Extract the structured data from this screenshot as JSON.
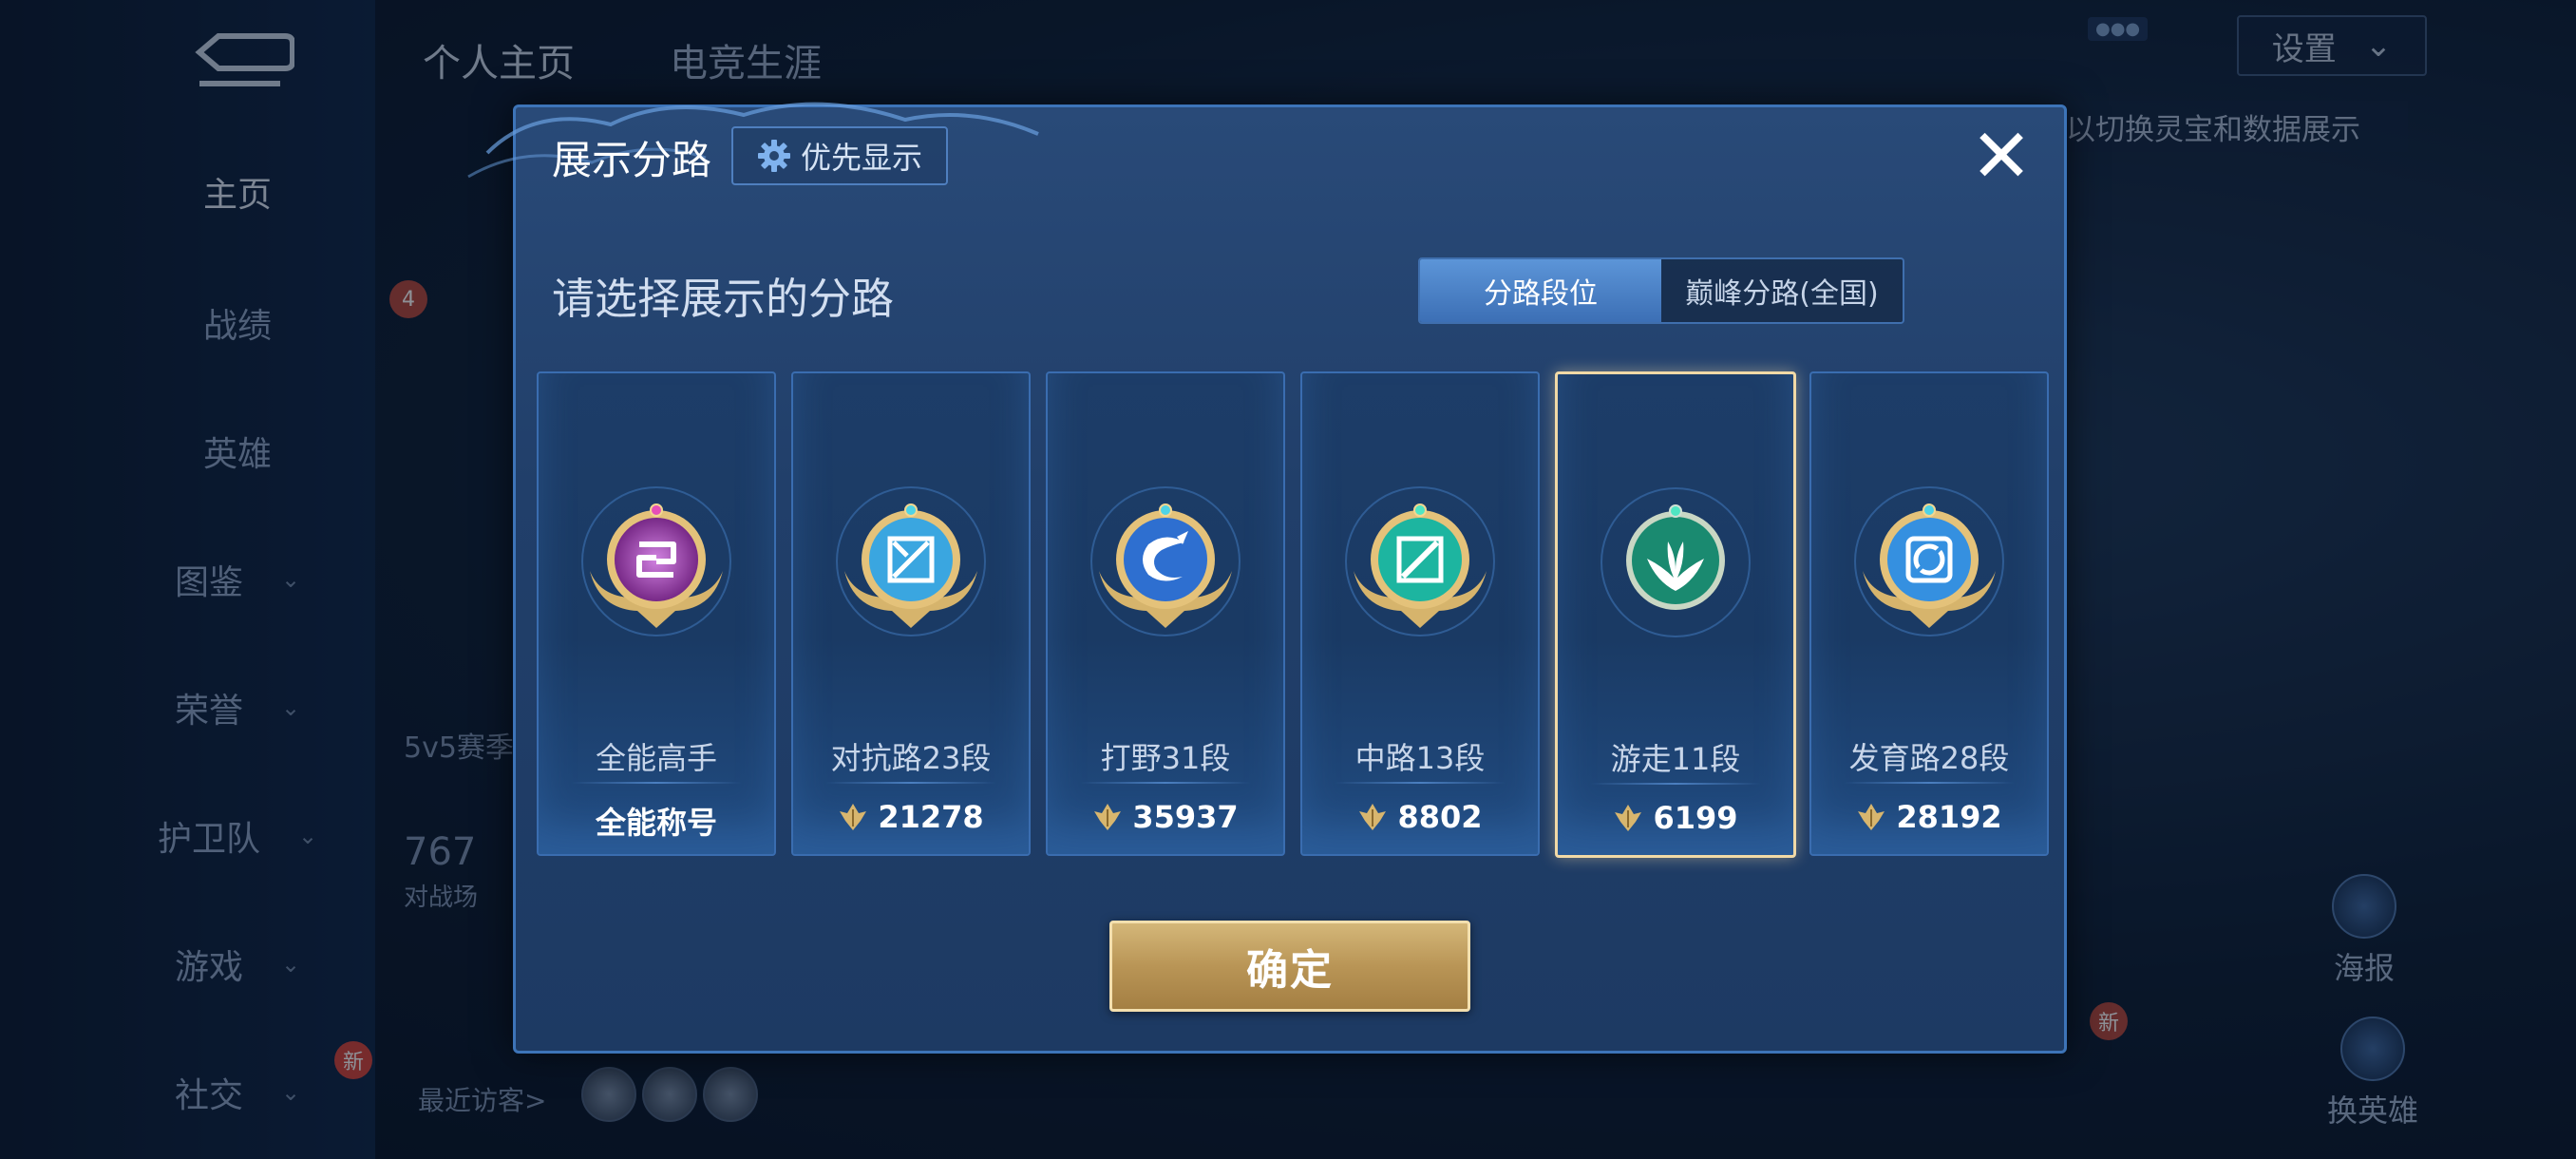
{
  "background": {
    "sidebar": {
      "items": [
        {
          "label": "主页",
          "has_chevron": false,
          "active": true
        },
        {
          "label": "战绩",
          "has_chevron": false
        },
        {
          "label": "英雄",
          "has_chevron": false
        },
        {
          "label": "图鉴",
          "has_chevron": true
        },
        {
          "label": "荣誉",
          "has_chevron": true
        },
        {
          "label": "护卫队",
          "has_chevron": true
        },
        {
          "label": "游戏",
          "has_chevron": true
        },
        {
          "label": "社交",
          "has_chevron": true
        }
      ],
      "new_badge": "新"
    },
    "top_tabs": [
      "个人主页",
      "电竞生涯"
    ],
    "settings_label": "设置",
    "hint_text": "以切换灵宝和数据展示",
    "left_info": {
      "level_badge": "4",
      "mode_text": "5v5赛季",
      "number_text": "767",
      "number_caption": "对战场"
    },
    "recent_visitors_label": "最近访客>",
    "right_buttons": [
      {
        "label": "海报"
      },
      {
        "label": "换英雄"
      }
    ],
    "right_new_badge": "新"
  },
  "modal": {
    "title": "展示分路",
    "priority_button": "优先显示",
    "close_symbol": "✕",
    "subtitle": "请选择展示的分路",
    "tabs": [
      {
        "label": "分路段位",
        "active": true
      },
      {
        "label": "巅峰分路(全国)",
        "active": false
      }
    ],
    "cards": [
      {
        "name": "全能高手",
        "score": "全能称号",
        "has_score_icon": false,
        "badge": "purple-allround-badge",
        "badge_color": "#b83fd0",
        "selected": false
      },
      {
        "name": "对抗路23段",
        "score": "21278",
        "has_score_icon": true,
        "badge": "clash-lane-badge",
        "badge_color": "#3aa6e0",
        "selected": false
      },
      {
        "name": "打野31段",
        "score": "35937",
        "has_score_icon": true,
        "badge": "jungle-dragon-badge",
        "badge_color": "#2e6fd0",
        "selected": false
      },
      {
        "name": "中路13段",
        "score": "8802",
        "has_score_icon": true,
        "badge": "mid-lane-badge",
        "badge_color": "#1db5a0",
        "selected": false
      },
      {
        "name": "游走11段",
        "score": "6199",
        "has_score_icon": true,
        "badge": "roam-wings-badge",
        "badge_color": "#1a8a70",
        "selected": true
      },
      {
        "name": "发育路28段",
        "score": "28192",
        "has_score_icon": true,
        "badge": "farm-lane-badge",
        "badge_color": "#3590e0",
        "selected": false
      }
    ],
    "confirm_button": "确定"
  },
  "colors": {
    "gold": "#d4b779",
    "selected_border": "#f1d9a6",
    "panel": "#213f6a"
  }
}
